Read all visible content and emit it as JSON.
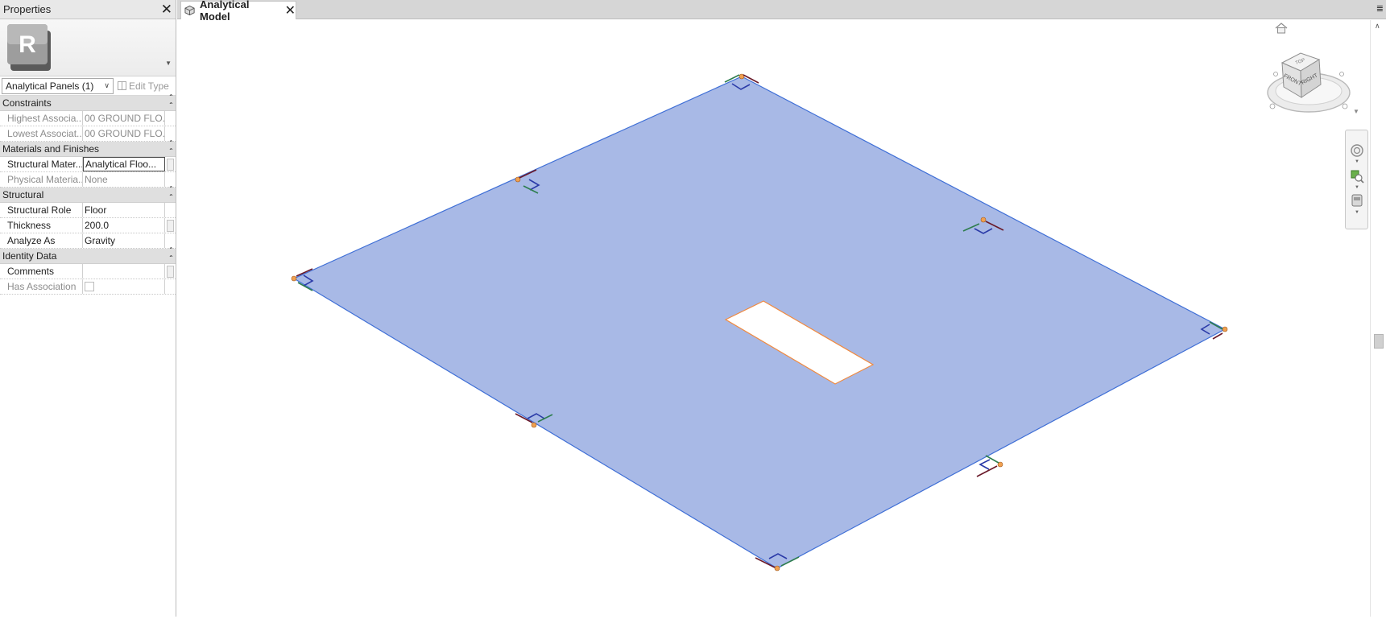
{
  "properties": {
    "title": "Properties",
    "type_selector": "Analytical Panels (1)",
    "edit_type_label": "Edit Type",
    "groups": [
      {
        "name": "Constraints",
        "rows": [
          {
            "name": "Highest Associa...",
            "value": "00 GROUND FLO...",
            "readonly": true
          },
          {
            "name": "Lowest Associat...",
            "value": "00 GROUND FLO...",
            "readonly": true
          }
        ]
      },
      {
        "name": "Materials and Finishes",
        "rows": [
          {
            "name": "Structural Mater...",
            "value": "Analytical Floo...",
            "readonly": false
          },
          {
            "name": "Physical Materia...",
            "value": "None",
            "readonly": true
          }
        ]
      },
      {
        "name": "Structural",
        "rows": [
          {
            "name": "Structural Role",
            "value": "Floor",
            "readonly": false
          },
          {
            "name": "Thickness",
            "value": "200.0",
            "readonly": false
          },
          {
            "name": "Analyze As",
            "value": "Gravity",
            "readonly": false
          }
        ]
      },
      {
        "name": "Identity Data",
        "rows": [
          {
            "name": "Comments",
            "value": "",
            "readonly": false
          },
          {
            "name": "Has Association",
            "value": "",
            "readonly": true
          }
        ]
      }
    ]
  },
  "view_tab": {
    "label": "Analytical Model"
  },
  "viewcube": {
    "top": "TOP",
    "front": "FRONT",
    "right": "RIGHT"
  },
  "colors": {
    "panel_fill": "#a8b9e6",
    "panel_edge": "#3f6fd6",
    "node": "#f0a050",
    "opening_edge": "#f08a40",
    "local_axis_x": "#2a3aa8",
    "local_axis_y": "#2e7d4e"
  }
}
